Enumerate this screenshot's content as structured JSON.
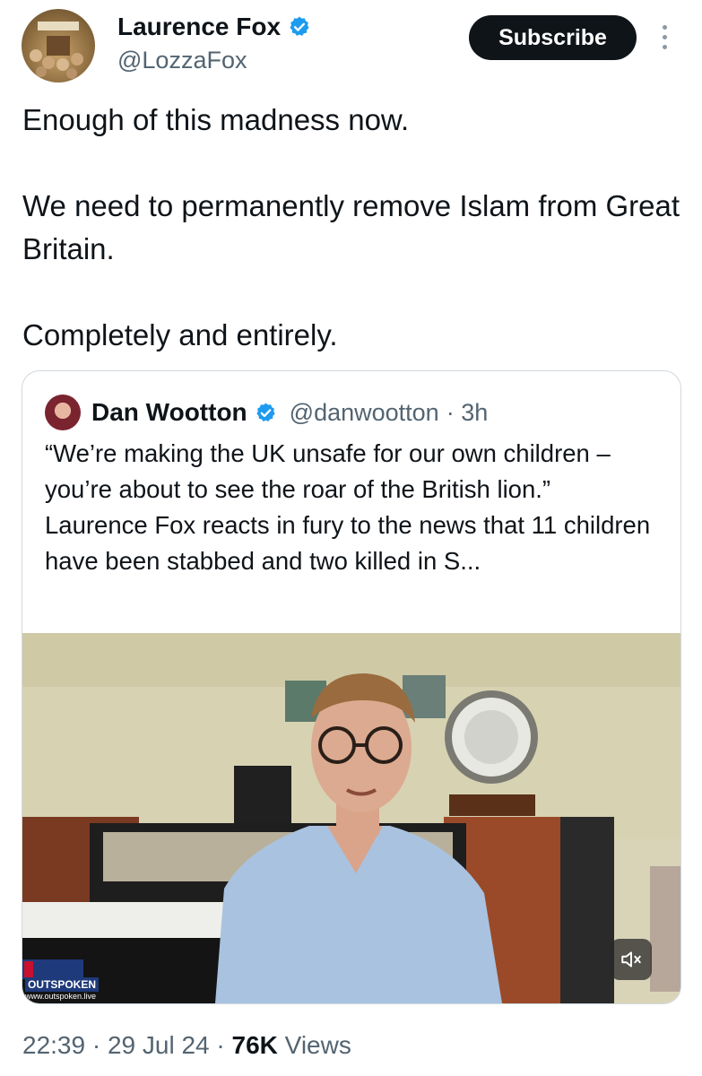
{
  "author": {
    "display_name": "Laurence Fox",
    "handle": "@LozzaFox",
    "subscribe_label": "Subscribe",
    "verified": true
  },
  "tweet": {
    "line1": "Enough of this madness now.",
    "line2": "We need to permanently remove Islam from Great Britain.",
    "line3": "Completely and entirely."
  },
  "quoted": {
    "display_name": "Dan Wootton",
    "handle": "@danwootton",
    "time": "· 3h",
    "quote_text": "“We’re making the UK unsafe for our own children – you’re about to see the roar of the British lion.”",
    "body_text": "Laurence Fox reacts in fury to the news that 11 children have been stabbed and two killed in S...",
    "video": {
      "watermark_brand": "OUTSPOKEN",
      "watermark_url": "www.outspoken.live",
      "muted": true
    }
  },
  "meta": {
    "time": "22:39",
    "date": "29 Jul 24",
    "views_count": "76K",
    "views_label": "Views",
    "sep": "·"
  },
  "colors": {
    "text": "#0f1419",
    "secondary": "#536471",
    "verified": "#1d9bf0",
    "border": "#cfd9de"
  }
}
